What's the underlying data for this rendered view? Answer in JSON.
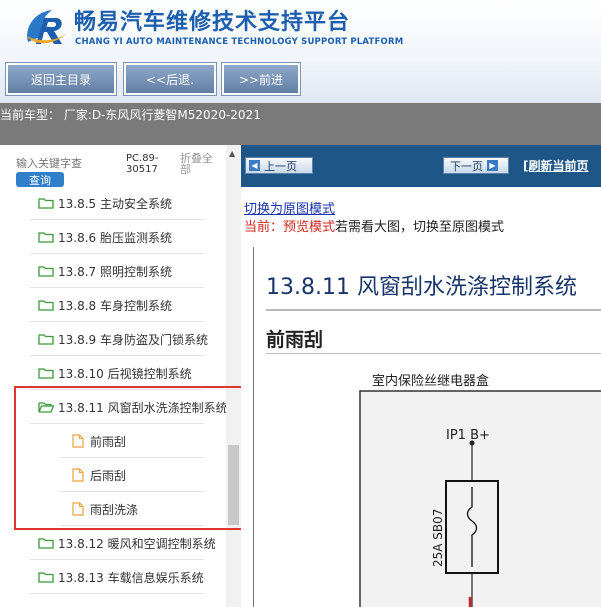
{
  "header": {
    "title_cn": "畅易汽车维修技术支持平台",
    "title_en": "CHANG YI AUTO MAINTENANCE TECHNOLOGY SUPPORT PLATFORM",
    "brand_color": "#1d5fae"
  },
  "nav": {
    "home_label": "返回主目录",
    "back_label": "<<后退.",
    "forward_label": ">>前进"
  },
  "vehicle": {
    "text": "当前车型：  厂家:D-东风风行菱智M52020-2021"
  },
  "sidebar": {
    "search_placeholder": "输入关键字查",
    "query_label": "查询",
    "pc_code": "PC.89-30517",
    "fold_label": "折叠全部",
    "items": [
      {
        "label": "13.8.5 主动安全系统",
        "type": "folder"
      },
      {
        "label": "13.8.6 胎压监测系统",
        "type": "folder"
      },
      {
        "label": "13.8.7 照明控制系统",
        "type": "folder"
      },
      {
        "label": "13.8.8 车身控制系统",
        "type": "folder"
      },
      {
        "label": "13.8.9 车身防盗及门锁系统",
        "type": "folder"
      },
      {
        "label": "13.8.10 后视镜控制系统",
        "type": "folder"
      },
      {
        "label": "13.8.11 风窗刮水洗涤控制系统",
        "type": "folder-open"
      },
      {
        "label": "前雨刮",
        "type": "file"
      },
      {
        "label": "后雨刮",
        "type": "file"
      },
      {
        "label": "雨刮洗涤",
        "type": "file"
      },
      {
        "label": "13.8.12 暖风和空调控制系统",
        "type": "folder"
      },
      {
        "label": "13.8.13 车载信息娱乐系统",
        "type": "folder"
      }
    ]
  },
  "pager": {
    "prev_label": "上一页",
    "next_label": "下一页",
    "refresh_label": "[刷新当前页"
  },
  "mode": {
    "switch_link": "切换为原图模式",
    "current_prefix": "当前：",
    "current_mode": "预览模式",
    "hint": "若需看大图，切换至原图模式"
  },
  "document": {
    "title": "13.8.11 风窗刮水洗涤控制系统",
    "section": "前雨刮",
    "box_label": "室内保险丝继电器盒",
    "pin_label": "IP1 B+",
    "fuse_label": "25A SB07"
  }
}
